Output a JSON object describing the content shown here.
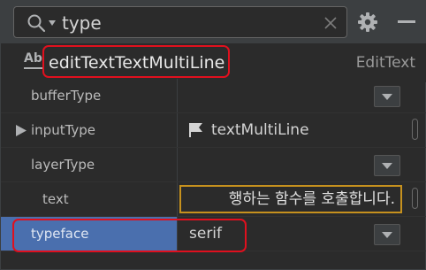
{
  "search": {
    "query": "type"
  },
  "component": {
    "id": "editTextTextMultiLine",
    "class": "EditText",
    "icon_text": "Ab"
  },
  "properties": [
    {
      "name": "bufferType",
      "value": ""
    },
    {
      "name": "inputType",
      "value": "textMultiLine"
    },
    {
      "name": "layerType",
      "value": ""
    },
    {
      "name": "text",
      "value": "행하는 함수를 호출합니다."
    },
    {
      "name": "typeface",
      "value": "serif"
    }
  ],
  "colors": {
    "background": "#2b2b2b",
    "toolbar": "#3c3f41",
    "selection": "#4a6fae",
    "input_focus_border": "#c6911e",
    "highlight_annotation": "#e0101e"
  },
  "icons": [
    "search-icon",
    "clear-icon",
    "gear-icon",
    "minimize-icon",
    "ab-text-icon",
    "flag-icon",
    "expand-arrow-icon",
    "chevron-down-icon"
  ]
}
